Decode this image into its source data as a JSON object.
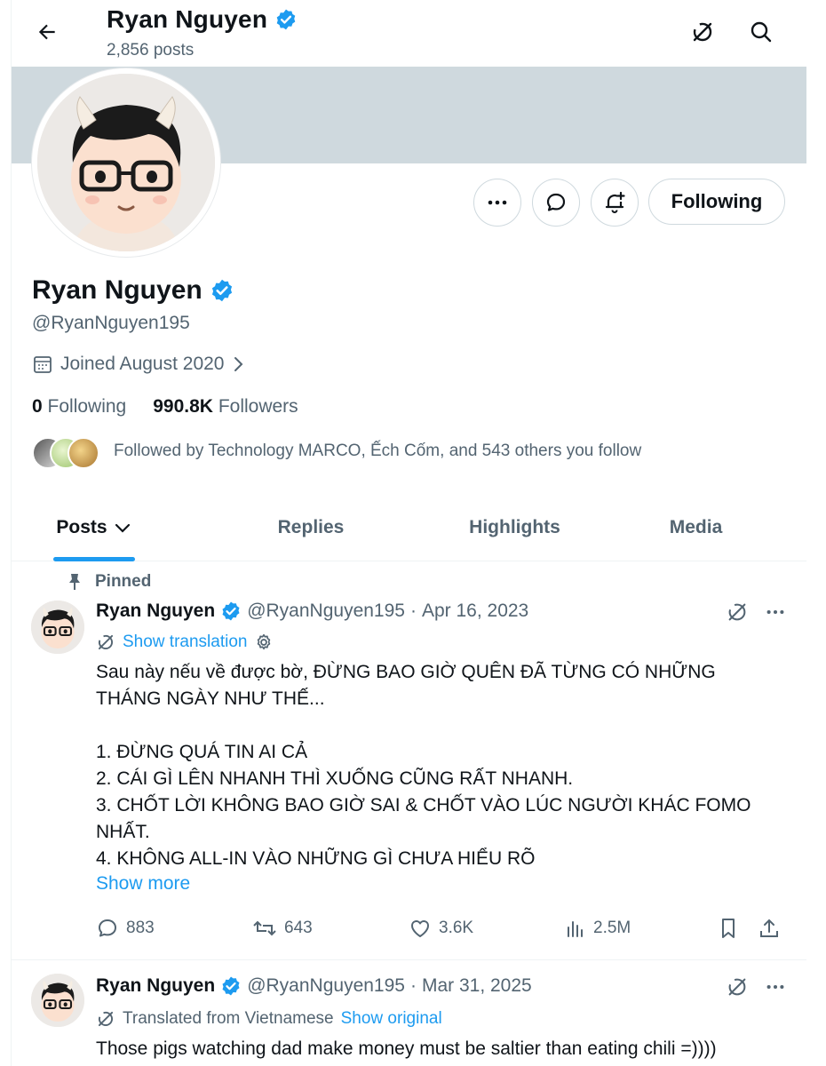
{
  "header": {
    "name": "Ryan Nguyen",
    "posts_count": "2,856 posts"
  },
  "profile": {
    "name": "Ryan Nguyen",
    "handle": "@RyanNguyen195",
    "joined": "Joined August 2020",
    "following_count": "0",
    "following_label": "Following",
    "followers_count": "990.8K",
    "followers_label": "Followers",
    "followed_by": "Followed by Technology MARCO, Ếch Cốm, and 543 others you follow",
    "following_button": "Following"
  },
  "tabs": [
    {
      "label": "Posts",
      "active": true
    },
    {
      "label": "Replies",
      "active": false
    },
    {
      "label": "Highlights",
      "active": false
    },
    {
      "label": "Media",
      "active": false
    }
  ],
  "tweets": [
    {
      "pinned_label": "Pinned",
      "name": "Ryan Nguyen",
      "handle": "@RyanNguyen195",
      "sep": "·",
      "date": "Apr 16, 2023",
      "translation_link": "Show translation",
      "text": "Sau này nếu về được bờ, ĐỪNG BAO GIỜ QUÊN ĐÃ TỪNG CÓ NHỮNG\nTHÁNG NGÀY NHƯ THẾ...\n\n1. ĐỪNG QUÁ TIN AI CẢ\n2. CÁI GÌ LÊN NHANH THÌ XUỐNG CŨNG RẤT NHANH.\n3. CHỐT LỜI KHÔNG BAO GIỜ SAI & CHỐT VÀO LÚC NGƯỜI KHÁC FOMO\nNHẤT.\n4. KHÔNG ALL-IN VÀO NHỮNG GÌ CHƯA HIỂU RÕ",
      "show_more": "Show more",
      "replies": "883",
      "reposts": "643",
      "likes": "3.6K",
      "views": "2.5M"
    },
    {
      "name": "Ryan Nguyen",
      "handle": "@RyanNguyen195",
      "sep": "·",
      "date": "Mar 31, 2025",
      "translated_from": "Translated from Vietnamese",
      "show_original": "Show original",
      "text": "Those pigs watching dad make money must be saltier than eating chili =))))"
    }
  ],
  "colors": {
    "accent": "#1d9bf0",
    "secondary_text": "#536471",
    "banner": "#cfd9de"
  }
}
